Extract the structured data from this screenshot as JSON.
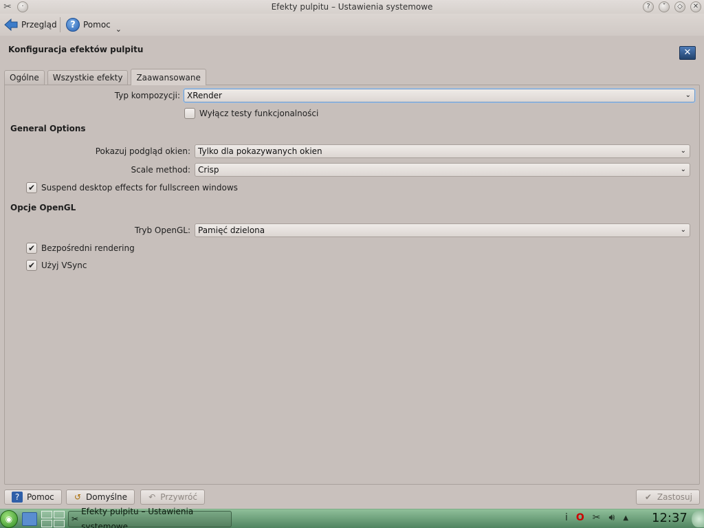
{
  "window": {
    "title": "Efekty pulpitu – Ustawienia systemowe"
  },
  "toolbar": {
    "back_label": "Przegląd",
    "help_label": "Pomoc"
  },
  "page": {
    "title": "Konfiguracja efektów pulpitu"
  },
  "tabs": [
    {
      "label": "Ogólne",
      "active": false
    },
    {
      "label": "Wszystkie efekty",
      "active": false
    },
    {
      "label": "Zaawansowane",
      "active": true
    }
  ],
  "advanced": {
    "compositing_type": {
      "label": "Typ kompozycji:",
      "value": "XRender"
    },
    "disable_checks": {
      "label": "Wyłącz testy funkcjonalności",
      "checked": false
    },
    "general_options": {
      "title": "General Options",
      "window_thumbnails": {
        "label": "Pokazuj podgląd okien:",
        "value": "Tylko dla pokazywanych okien"
      },
      "scale_method": {
        "label": "Scale method:",
        "value": "Crisp"
      },
      "suspend_fullscreen": {
        "label": "Suspend desktop effects for fullscreen windows",
        "checked": true
      }
    },
    "opengl_options": {
      "title": "Opcje OpenGL",
      "opengl_mode": {
        "label": "Tryb OpenGL:",
        "value": "Pamięć dzielona"
      },
      "direct_rendering": {
        "label": "Bezpośredni rendering",
        "checked": true
      },
      "vsync": {
        "label": "Użyj VSync",
        "checked": true
      }
    }
  },
  "buttons": {
    "help": "Pomoc",
    "defaults": "Domyślne",
    "reset": "Przywróć",
    "apply": "Zastosuj"
  },
  "taskbar": {
    "task_title": "Efekty pulpitu – Ustawienia systemowe",
    "clock": "12:37",
    "tray_icons": [
      "info-icon",
      "opera-icon",
      "klipper-icon",
      "volume-icon",
      "tray-expand-icon"
    ]
  }
}
